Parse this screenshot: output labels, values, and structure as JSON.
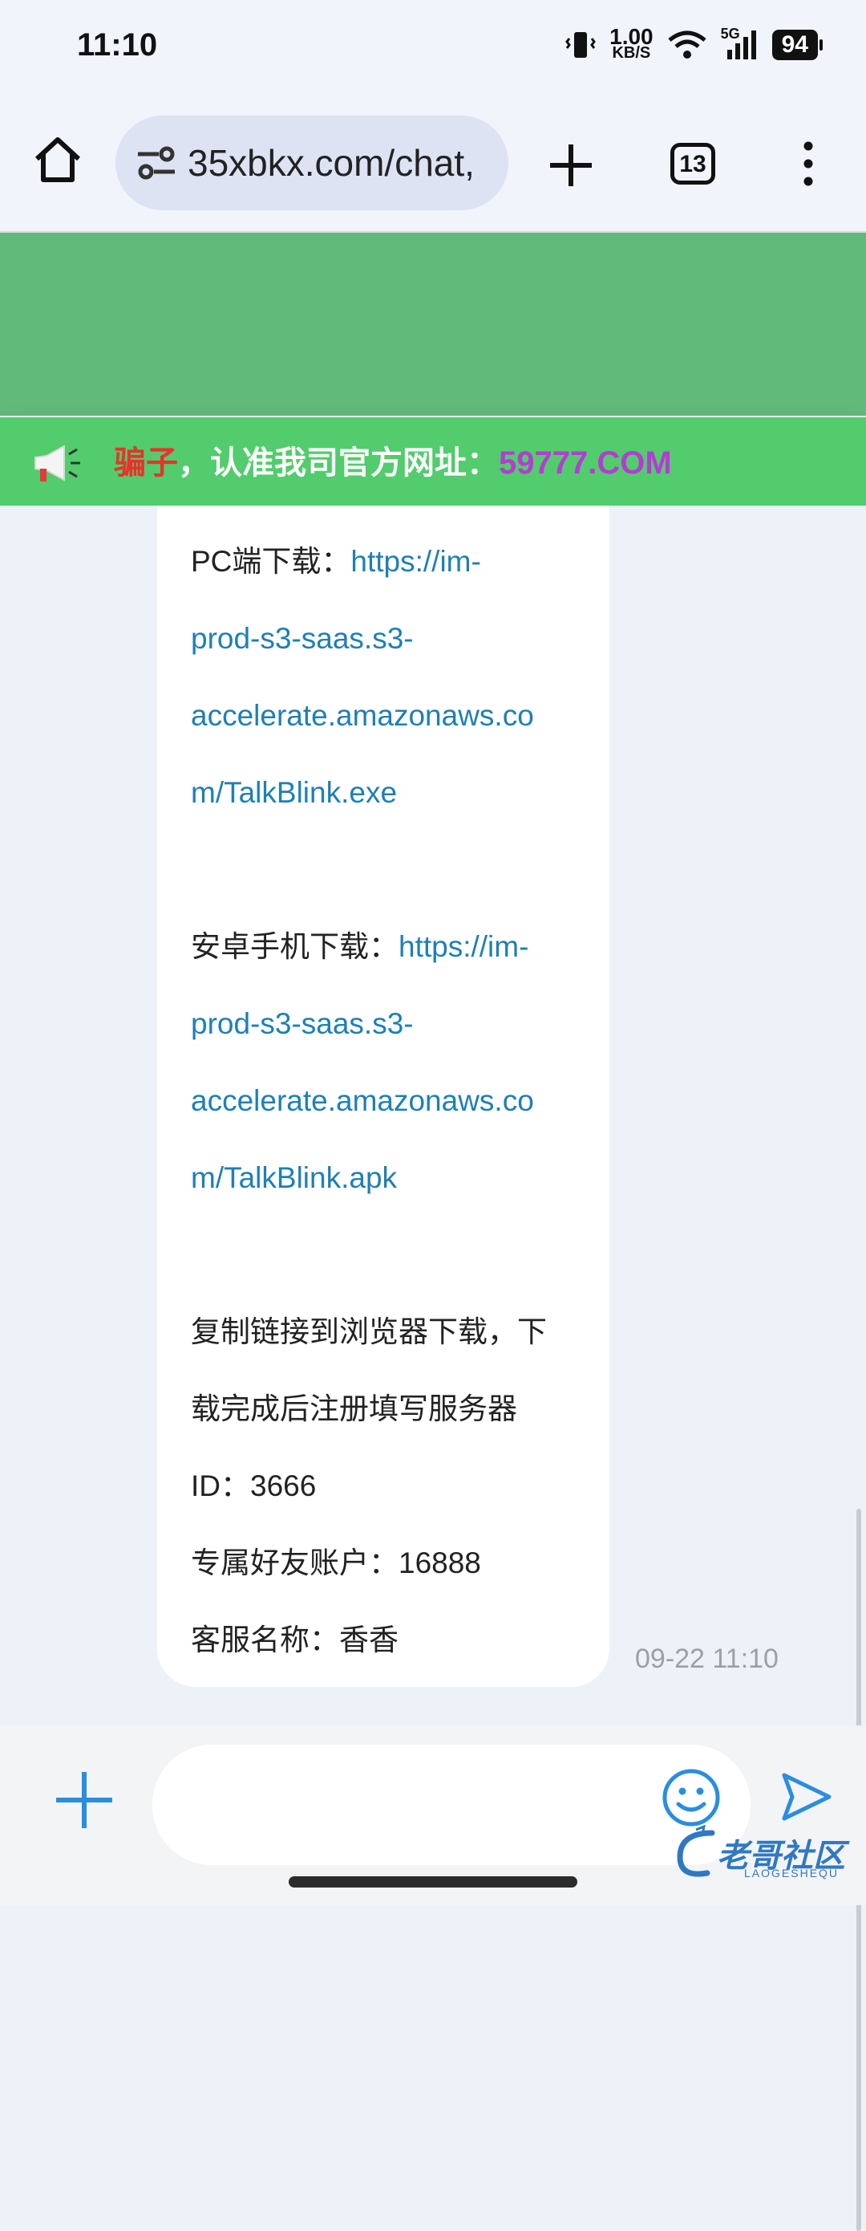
{
  "status_bar": {
    "time": "11:10",
    "net_speed_value": "1.00",
    "net_speed_unit": "KB/S",
    "network_type": "5G",
    "battery": "94"
  },
  "browser": {
    "url": "35xbkx.com/chat,",
    "tab_count": "13",
    "icons": [
      "home-icon",
      "site-settings-icon",
      "new-tab-icon",
      "tab-switcher-icon",
      "overflow-menu-icon"
    ]
  },
  "notice": {
    "warning_word": "骗子",
    "message": "，认准我司官方网址：",
    "official_site": "59777.COM"
  },
  "message": {
    "pc_label": "PC端下载：",
    "pc_link_lines": [
      "https://im-",
      "prod-s3-saas.s3-",
      "accelerate.amazonaws.co",
      "m/TalkBlink.exe"
    ],
    "android_label": "安卓手机下载：",
    "android_link_lines": [
      "https://im-",
      "prod-s3-saas.s3-",
      "accelerate.amazonaws.co",
      "m/TalkBlink.apk"
    ],
    "instruction_lines": [
      "复制链接到浏览器下载，下",
      "载完成后注册填写服务器",
      "ID：3666",
      "专属好友账户：16888",
      "客服名称：香香"
    ],
    "timestamp": "09-22 11:10"
  },
  "composer": {
    "placeholder": ""
  },
  "watermark": {
    "text": "老哥社区",
    "sub": "LAOGESHEQU"
  },
  "colors": {
    "header_green": "#61b97a",
    "notice_green": "#52cc6c",
    "warning_red": "#e8322c",
    "site_purple": "#b63bd6",
    "link_blue": "#1f7fb5",
    "accent_blue": "#2a8de0"
  }
}
